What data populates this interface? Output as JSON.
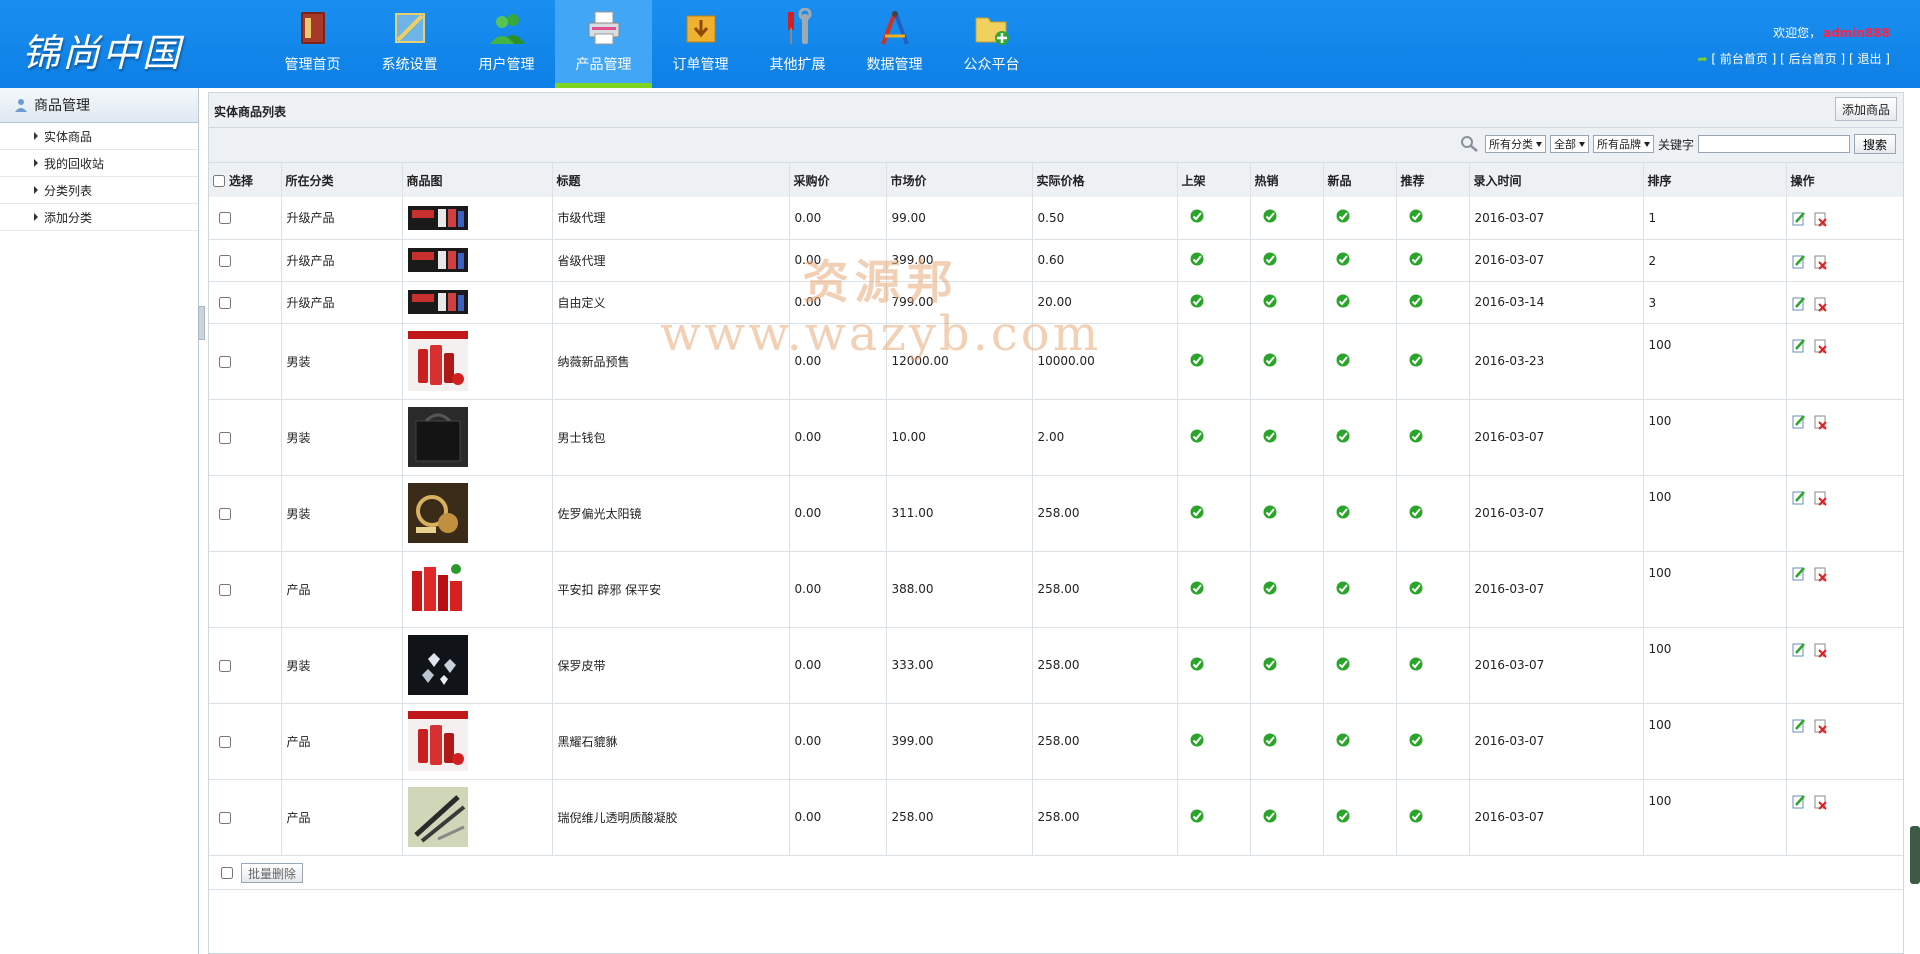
{
  "app": {
    "logo": "锦尚中国"
  },
  "nav": [
    {
      "label": "管理首页",
      "icon": "book-icon",
      "active": false
    },
    {
      "label": "系统设置",
      "icon": "ruler-icon",
      "active": false
    },
    {
      "label": "用户管理",
      "icon": "users-icon",
      "active": false
    },
    {
      "label": "产品管理",
      "icon": "printer-icon",
      "active": true
    },
    {
      "label": "订单管理",
      "icon": "download-box-icon",
      "active": false
    },
    {
      "label": "其他扩展",
      "icon": "tools-icon",
      "active": false
    },
    {
      "label": "数据管理",
      "icon": "compass-icon",
      "active": false
    },
    {
      "label": "公众平台",
      "icon": "folder-add-icon",
      "active": false
    }
  ],
  "user": {
    "welcome": "欢迎您，",
    "name": "admin888",
    "links": [
      "[ 前台首页 ]",
      "[ 后台首页 ]",
      "[ 退出 ]"
    ]
  },
  "sidebar": {
    "title": "商品管理",
    "items": [
      "实体商品",
      "我的回收站",
      "分类列表",
      "添加分类"
    ]
  },
  "panel": {
    "title": "实体商品列表",
    "add_label": "添加商品"
  },
  "filters": {
    "category": "所有分类",
    "status": "全部",
    "brand": "所有品牌",
    "keyword_label": "关键字",
    "keyword_value": "",
    "search_label": "搜索"
  },
  "table": {
    "headers": [
      "选择",
      "所在分类",
      "商品图",
      "标题",
      "采购价",
      "市场价",
      "实际价格",
      "上架",
      "热销",
      "新品",
      "推荐",
      "录入时间",
      "排序",
      "操作"
    ],
    "rows": [
      {
        "category": "升级产品",
        "title": "市级代理",
        "cost": "0.00",
        "market": "99.00",
        "price": "0.50",
        "date": "2016-03-07",
        "sort": "1",
        "thumb": "banner"
      },
      {
        "category": "升级产品",
        "title": "省级代理",
        "cost": "0.00",
        "market": "399.00",
        "price": "0.60",
        "date": "2016-03-07",
        "sort": "2",
        "thumb": "banner"
      },
      {
        "category": "升级产品",
        "title": "自由定义",
        "cost": "0.00",
        "market": "799.00",
        "price": "20.00",
        "date": "2016-03-14",
        "sort": "3",
        "thumb": "banner"
      },
      {
        "category": "男装",
        "title": "纳薇新品预售",
        "cost": "0.00",
        "market": "12000.00",
        "price": "10000.00",
        "date": "2016-03-23",
        "sort": "100",
        "thumb": "red-bottles"
      },
      {
        "category": "男装",
        "title": "男士钱包",
        "cost": "0.00",
        "market": "10.00",
        "price": "2.00",
        "date": "2016-03-07",
        "sort": "100",
        "thumb": "black-bag"
      },
      {
        "category": "男装",
        "title": "佐罗偏光太阳镜",
        "cost": "0.00",
        "market": "311.00",
        "price": "258.00",
        "date": "2016-03-07",
        "sort": "100",
        "thumb": "jewelry"
      },
      {
        "category": "产品",
        "title": "平安扣 辟邪 保平安",
        "cost": "0.00",
        "market": "388.00",
        "price": "258.00",
        "date": "2016-03-07",
        "sort": "100",
        "thumb": "red-set"
      },
      {
        "category": "男装",
        "title": "保罗皮带",
        "cost": "0.00",
        "market": "333.00",
        "price": "258.00",
        "date": "2016-03-07",
        "sort": "100",
        "thumb": "diamonds"
      },
      {
        "category": "产品",
        "title": "黑耀石貔貅",
        "cost": "0.00",
        "market": "399.00",
        "price": "258.00",
        "date": "2016-03-07",
        "sort": "100",
        "thumb": "red-bottles"
      },
      {
        "category": "产品",
        "title": "瑞倪维儿透明质酸凝胶",
        "cost": "0.00",
        "market": "258.00",
        "price": "258.00",
        "date": "2016-03-07",
        "sort": "100",
        "thumb": "pens"
      }
    ]
  },
  "bulk": {
    "delete_label": "批量删除"
  },
  "watermark": {
    "cn": "资源邦",
    "url": "www.wazyb.com"
  },
  "colors": {
    "topbar": "#0d7fe6",
    "active_tab": "#41a6f5",
    "active_underline": "#7ed321",
    "username": "#ff2244",
    "check": "#1a9a1a"
  }
}
